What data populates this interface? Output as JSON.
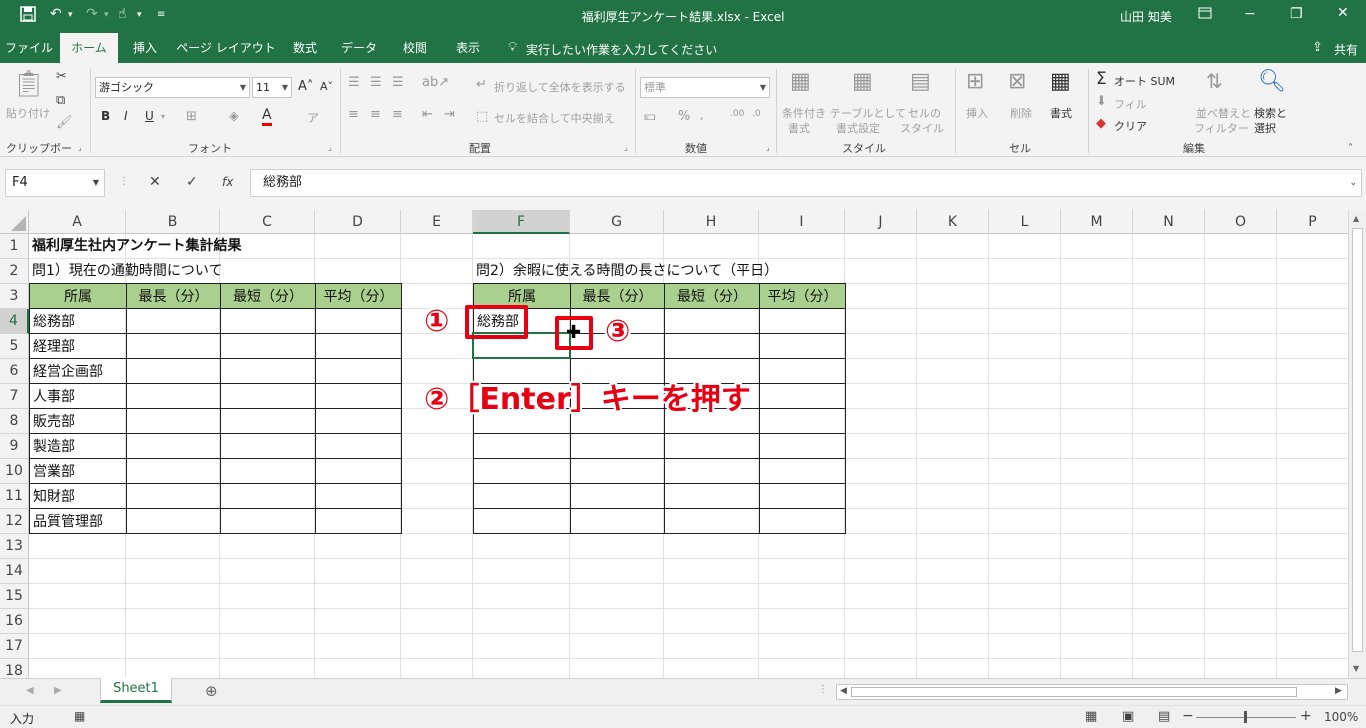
{
  "window": {
    "title": "福利厚生アンケート結果.xlsx  -  Excel",
    "user": "山田 知美",
    "share": "共有"
  },
  "tabs": [
    "ファイル",
    "ホーム",
    "挿入",
    "ページ レイアウト",
    "数式",
    "データ",
    "校閲",
    "表示"
  ],
  "tell_me": "実行したい作業を入力してください",
  "ribbon": {
    "clipboard": {
      "paste": "貼り付け",
      "label": "クリップボード"
    },
    "font": {
      "name": "游ゴシック",
      "size": "11",
      "label": "フォント"
    },
    "alignment": {
      "wrap": "折り返して全体を表示する",
      "merge": "セルを結合して中央揃え",
      "label": "配置"
    },
    "number": {
      "format": "標準",
      "label": "数値"
    },
    "styles": {
      "conditional1": "条件付き",
      "conditional2": "書式",
      "table1": "テーブルとして",
      "table2": "書式設定",
      "cell1": "セルの",
      "cell2": "スタイル",
      "label": "スタイル"
    },
    "cells": {
      "insert": "挿入",
      "delete": "削除",
      "format": "書式",
      "label": "セル"
    },
    "editing": {
      "autosum": "オート SUM",
      "fill": "フィル",
      "clear": "クリア",
      "sort1": "並べ替えと",
      "sort2": "フィルター",
      "find1": "検索と",
      "find2": "選択",
      "label": "編集"
    }
  },
  "formula": {
    "namebox": "F4",
    "fx": "fx",
    "content": "総務部"
  },
  "columns": [
    "A",
    "B",
    "C",
    "D",
    "E",
    "F",
    "G",
    "H",
    "I",
    "J",
    "K",
    "L",
    "M",
    "N",
    "O",
    "P"
  ],
  "rows": [
    "1",
    "2",
    "3",
    "4",
    "5",
    "6",
    "7",
    "8",
    "9",
    "10",
    "11",
    "12",
    "13",
    "14",
    "15",
    "16",
    "17",
    "18"
  ],
  "cells": {
    "a1": "福利厚生社内アンケート集計結果",
    "a2": "問1）現在の通勤時間について",
    "f2": "問2）余暇に使える時間の長さについて（平日）"
  },
  "table1": {
    "headers": [
      "所属",
      "最長（分）",
      "最短（分）",
      "平均（分）"
    ],
    "rows": [
      "総務部",
      "経理部",
      "経営企画部",
      "人事部",
      "販売部",
      "製造部",
      "営業部",
      "知財部",
      "品質管理部"
    ]
  },
  "table2": {
    "headers": [
      "所属",
      "最長（分）",
      "最短（分）",
      "平均（分）"
    ],
    "f4": "総務部"
  },
  "annotations": {
    "step1": "①",
    "step2": "②［Enter］キーを押す",
    "step3": "③"
  },
  "sheet": {
    "tab": "Sheet1"
  },
  "status": {
    "mode": "入力",
    "zoom": "100%"
  },
  "colors": {
    "excel_green": "#217346",
    "header_fill": "#a9d08e",
    "annotation_red": "#e60012"
  }
}
